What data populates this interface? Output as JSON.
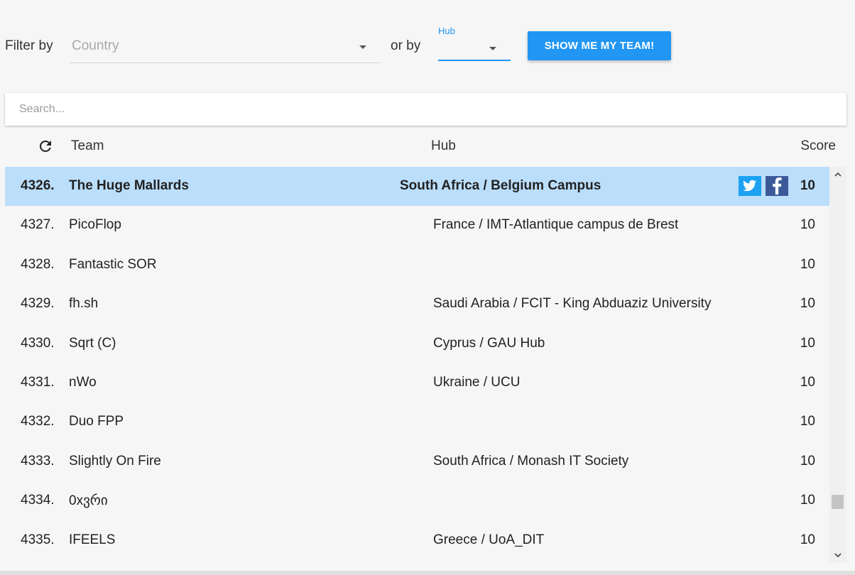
{
  "filters": {
    "filter_by_label": "Filter by",
    "country_placeholder": "Country",
    "or_by_label": "or by",
    "hub_label": "Hub",
    "hub_value": "",
    "show_team_button": "SHOW ME MY TEAM!"
  },
  "search": {
    "placeholder": "Search..."
  },
  "table": {
    "headers": {
      "team": "Team",
      "hub": "Hub",
      "score": "Score"
    },
    "rows": [
      {
        "rank": "4326.",
        "team": "The Huge Mallards",
        "hub": "South Africa / Belgium Campus",
        "score": "10",
        "highlighted": true
      },
      {
        "rank": "4327.",
        "team": "PicoFlop",
        "hub": "France / IMT-Atlantique campus de Brest",
        "score": "10"
      },
      {
        "rank": "4328.",
        "team": "Fantastic SOR",
        "hub": "",
        "score": "10"
      },
      {
        "rank": "4329.",
        "team": "fh.sh",
        "hub": "Saudi Arabia / FCIT - King Abduaziz University",
        "score": "10"
      },
      {
        "rank": "4330.",
        "team": "Sqrt (C)",
        "hub": "Cyprus / GAU Hub",
        "score": "10"
      },
      {
        "rank": "4331.",
        "team": "nWo",
        "hub": "Ukraine / UCU",
        "score": "10"
      },
      {
        "rank": "4332.",
        "team": "Duo FPP",
        "hub": "",
        "score": "10"
      },
      {
        "rank": "4333.",
        "team": "Slightly On Fire",
        "hub": "South Africa / Monash IT Society",
        "score": "10"
      },
      {
        "rank": "4334.",
        "team": "0xვრი",
        "hub": "",
        "score": "10"
      },
      {
        "rank": "4335.",
        "team": "IFEELS",
        "hub": "Greece / UoA_DIT",
        "score": "10"
      }
    ]
  },
  "icons": {
    "refresh": "refresh-icon",
    "twitter": "twitter-icon",
    "facebook": "facebook-icon"
  },
  "colors": {
    "accent": "#2196f3",
    "highlight_row": "#bbdefb",
    "twitter": "#1da1f2",
    "facebook": "#3b5998"
  }
}
